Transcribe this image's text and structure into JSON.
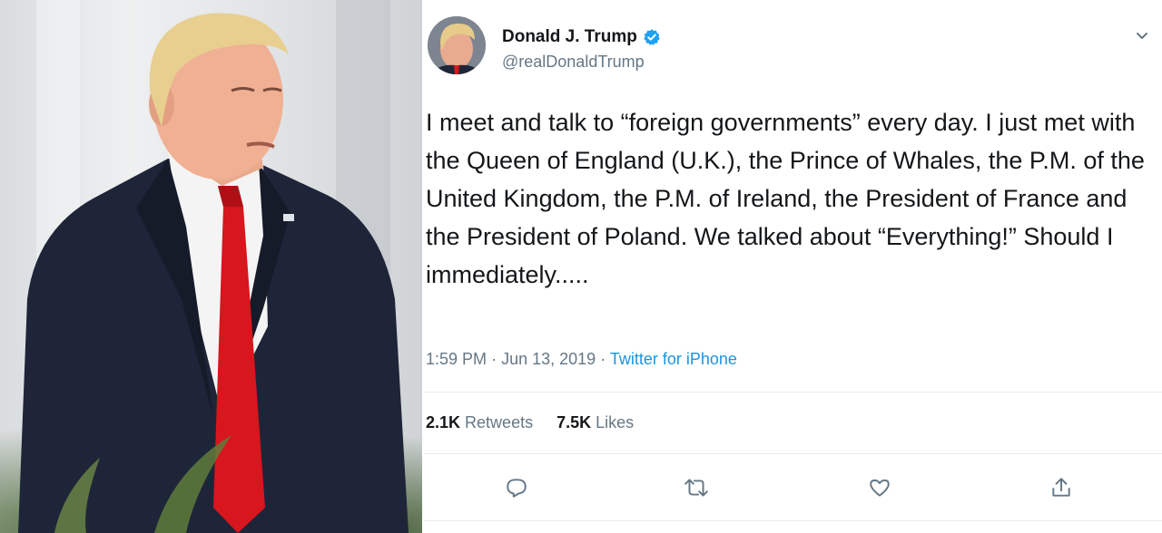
{
  "tweet": {
    "display_name": "Donald J. Trump",
    "handle": "@realDonaldTrump",
    "text": "I meet and talk to “foreign governments” every day. I just met with the Queen of England (U.K.), the Prince of Whales, the P.M. of the United Kingdom, the P.M. of Ireland, the President of France and the President of Poland. We talked about “Everything!” Should I immediately.....",
    "time": "1:59 PM",
    "separator": "·",
    "date": "Jun 13, 2019",
    "source": "Twitter for iPhone",
    "retweets_count": "2.1K",
    "retweets_label": "Retweets",
    "likes_count": "7.5K",
    "likes_label": "Likes"
  },
  "icons": {
    "verified": "verified-badge-icon",
    "menu": "chevron-down-icon",
    "reply": "reply-icon",
    "retweet": "retweet-icon",
    "like": "heart-icon",
    "share": "share-icon"
  },
  "colors": {
    "accent": "#1da1f2",
    "link": "#1b95e0",
    "secondary_text": "#657786",
    "primary_text": "#14171a",
    "tie": "#d7161e",
    "suit": "#1f2538"
  }
}
